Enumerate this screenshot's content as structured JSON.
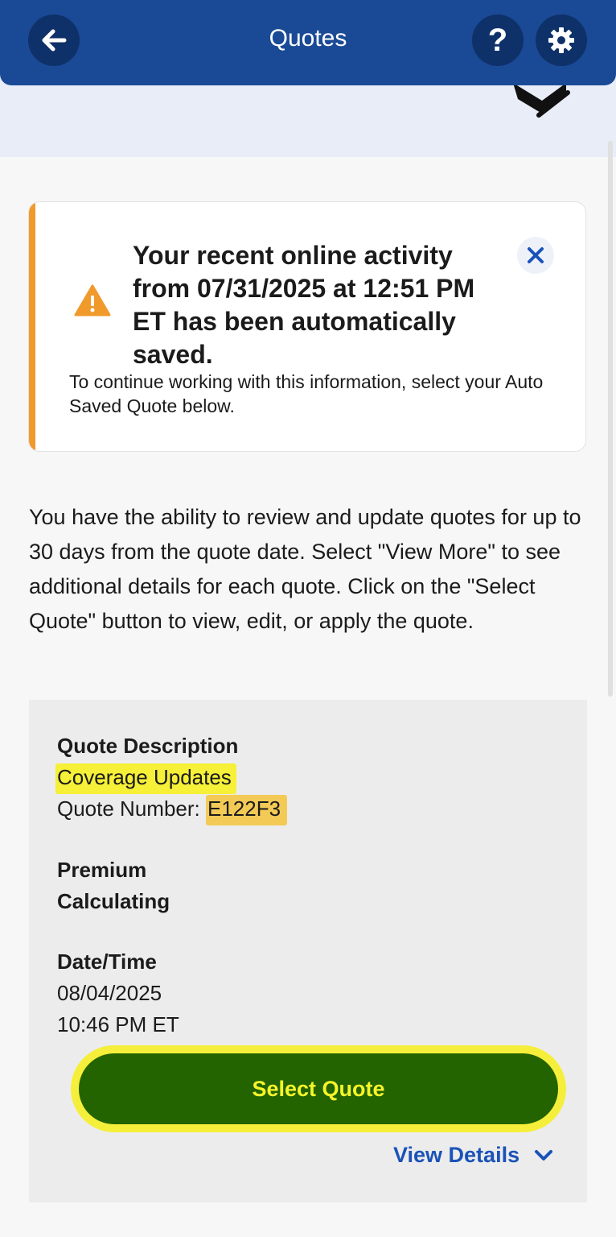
{
  "header": {
    "title": "Quotes"
  },
  "alert": {
    "title": "Your recent online activity from 07/31/2025 at 12:51 PM ET has been automatically saved.",
    "body": "To continue working with this information, select your Auto Saved Quote below."
  },
  "intro": "You have the ability to review and update quotes for up to 30 days from the quote date. Select \"View More\" to see additional details for each quote. Click on the \"Select Quote\" button to view, edit, or apply the quote.",
  "quote": {
    "description_label": "Quote Description",
    "description": "Coverage Updates",
    "number_label": "Quote Number:",
    "number": "E122F3",
    "premium_label": "Premium",
    "premium": "Calculating",
    "datetime_label": "Date/Time",
    "date": "08/04/2025",
    "time": "10:46 PM ET",
    "select_label": "Select Quote",
    "details_label": "View Details"
  },
  "colors": {
    "header": "#1a4a96",
    "alert_bar": "#f19a2c",
    "select_button": "#236300",
    "link": "#1a52b8",
    "highlight": "#f6f028"
  },
  "icons": [
    "back-arrow-icon",
    "help-icon",
    "gear-icon",
    "warning-icon",
    "close-icon",
    "chevron-down-icon"
  ]
}
